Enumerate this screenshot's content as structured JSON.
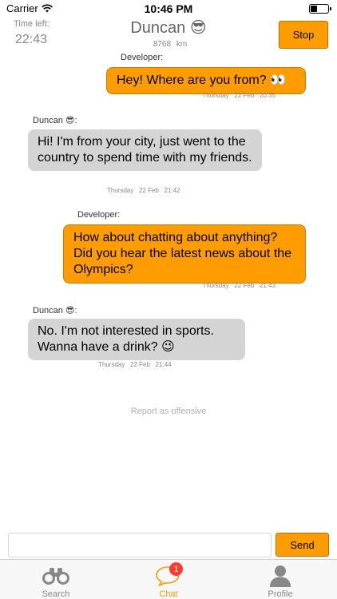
{
  "status_bar": {
    "carrier": "Carrier",
    "time": "10:46 PM",
    "battery_level": 0.4
  },
  "header": {
    "time_left_label": "Time left:",
    "time_left_value": "22:43",
    "name": "Duncan 😎",
    "distance_value": "8768",
    "distance_unit": "km",
    "stop_label": "Stop"
  },
  "messages": [
    {
      "sender": "Developer:",
      "text": "Hey! Where are you from? 👀",
      "stamp_day": "Thursday",
      "stamp_date": "22 Feb",
      "stamp_time": "20:35"
    },
    {
      "sender": "Duncan 😎:",
      "text": "Hi! I'm from your city, just went to the country to spend time with my friends.",
      "stamp_day": "Thursday",
      "stamp_date": "22 Feb",
      "stamp_time": "21:42"
    },
    {
      "sender": "Developer:",
      "text": "How about chatting about anything? Did you hear the latest news about the Olympics?",
      "stamp_day": "Thursday",
      "stamp_date": "22 Feb",
      "stamp_time": "21:43"
    },
    {
      "sender": "Duncan 😎:",
      "text": "No. I'm not interested in sports. Wanna have a drink? 😉",
      "stamp_day": "Thursday",
      "stamp_date": "22 Feb",
      "stamp_time": "21:44"
    }
  ],
  "report_label": "Report as offensive",
  "composer": {
    "value": "",
    "send_label": "Send"
  },
  "tabs": [
    {
      "label": "Search",
      "icon": "binoculars-icon"
    },
    {
      "label": "Chat",
      "icon": "chat-bubble-icon",
      "badge": "1",
      "active": true
    },
    {
      "label": "Profile",
      "icon": "person-icon"
    }
  ],
  "colors": {
    "accent": "#ff9c00",
    "incoming_bubble": "#d4d4d4",
    "badge": "#ff3b30"
  }
}
